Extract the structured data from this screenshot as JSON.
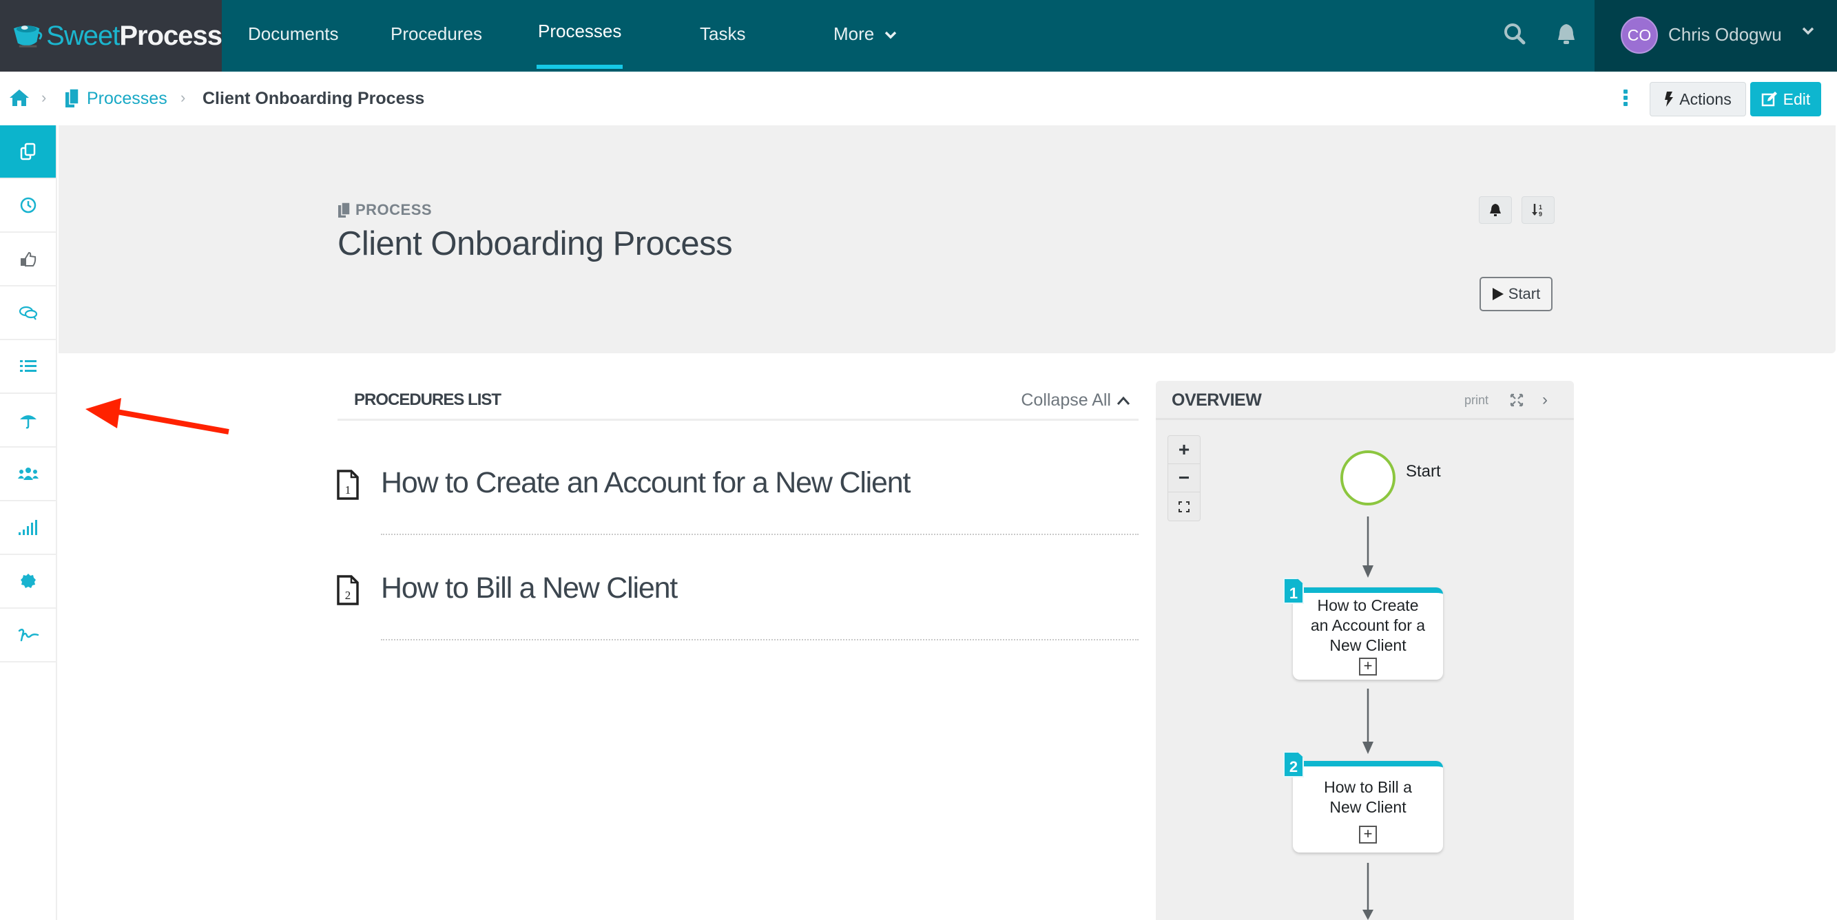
{
  "brand": {
    "name_part1": "Sweet",
    "name_part2": "Process"
  },
  "nav": {
    "items": [
      {
        "label": "Documents",
        "active": false
      },
      {
        "label": "Procedures",
        "active": false
      },
      {
        "label": "Processes",
        "active": true
      },
      {
        "label": "Tasks",
        "active": false
      },
      {
        "label": "More",
        "active": false
      }
    ],
    "search_icon": "search-icon",
    "notifications_icon": "bell-icon"
  },
  "user": {
    "initials": "CO",
    "name": "Chris Odogwu",
    "avatar_color": "#9b6fd3"
  },
  "breadcrumb": {
    "home_icon": "home-icon",
    "items": [
      {
        "label": "Processes",
        "link": true
      },
      {
        "label": "Client Onboarding Process",
        "link": false
      }
    ]
  },
  "toolbar": {
    "actions_label": "Actions",
    "edit_label": "Edit"
  },
  "sidebar": {
    "items": [
      {
        "icon": "documents-icon",
        "active": true
      },
      {
        "icon": "history-clock-icon",
        "active": false
      },
      {
        "icon": "thumbs-up-icon",
        "active": false
      },
      {
        "icon": "comments-icon",
        "active": false
      },
      {
        "icon": "checklist-icon",
        "active": false
      },
      {
        "icon": "umbrella-icon",
        "active": false
      },
      {
        "icon": "team-icon",
        "active": false
      },
      {
        "icon": "stats-bars-icon",
        "active": false
      },
      {
        "icon": "badge-icon",
        "active": false
      },
      {
        "icon": "signature-icon",
        "active": false
      }
    ]
  },
  "header": {
    "eyebrow": "PROCESS",
    "title": "Client Onboarding Process",
    "start_label": "Start"
  },
  "procedures_list": {
    "title": "PROCEDURES LIST",
    "collapse_label": "Collapse All",
    "items": [
      {
        "number": "1",
        "title": "How to Create an Account for a New Client"
      },
      {
        "number": "2",
        "title": "How to Bill a New Client"
      }
    ]
  },
  "overview": {
    "title": "OVERVIEW",
    "print_label": "print",
    "zoom_in": "+",
    "zoom_out": "−",
    "start_node_label": "Start",
    "nodes": [
      {
        "number": "1",
        "lines": [
          "How to Create",
          "an Account for a",
          "New Client"
        ]
      },
      {
        "number": "2",
        "lines": [
          "How to Bill a",
          "New Client"
        ]
      }
    ]
  },
  "colors": {
    "nav_bg": "#005b6a",
    "logo_bg": "#33373f",
    "user_bg": "#00404b",
    "accent": "#0eb6cf",
    "start_node_stroke": "#8cc63f",
    "annotation": "#ff2200"
  }
}
